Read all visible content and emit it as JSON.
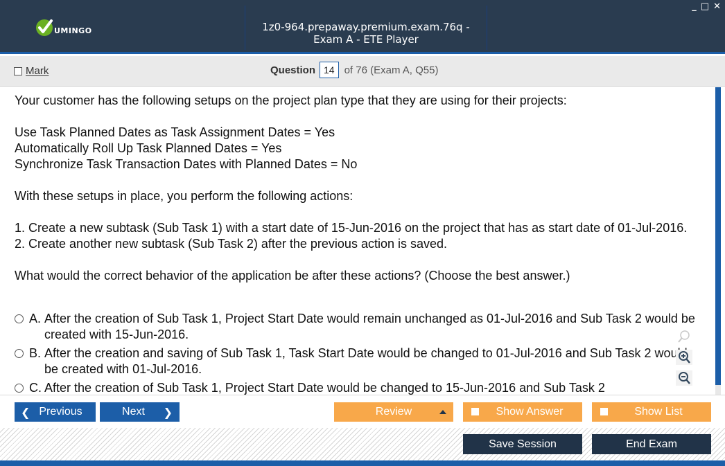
{
  "window": {
    "title": "1z0-964.prepaway.premium.exam.76q - Exam A - ETE Player",
    "logo_text": "UMINGO",
    "controls": [
      "_",
      "□",
      "✕"
    ]
  },
  "header": {
    "mark_label": "Mark",
    "question_label": "Question",
    "question_number": "14",
    "question_of": "of 76 (Exam A, Q55)"
  },
  "question": {
    "intro": "Your customer has the following setups on the project plan type that they are using for their projects:",
    "setups": [
      "Use Task Planned Dates as Task Assignment Dates = Yes",
      "Automatically Roll Up Task Planned Dates = Yes",
      "Synchronize Task Transaction Dates with Planned Dates = No"
    ],
    "actions_intro": "With these setups in place, you perform the following actions:",
    "actions": [
      "1. Create a new subtask (Sub Task 1) with a start date of 15-Jun-2016 on the project that has as start date of 01-Jul-2016.",
      "2. Create another new subtask (Sub Task 2) after the previous action is saved."
    ],
    "prompt": "What would the correct behavior of the application be after these actions? (Choose the best answer.)"
  },
  "answers": [
    {
      "letter": "A.",
      "text": "After the creation of Sub Task 1, Project Start Date would remain unchanged as 01-Jul-2016 and Sub Task 2 would be created with 15-Jun-2016."
    },
    {
      "letter": "B.",
      "text": "After the creation and saving of Sub Task 1, Task Start Date would be changed to 01-Jul-2016 and Sub Task 2 would be created with 01-Jul-2016."
    },
    {
      "letter": "C.",
      "text": "After the creation of Sub Task 1, Project Start Date would be changed to 15-Jun-2016 and Sub Task 2"
    }
  ],
  "nav": {
    "previous": "Previous",
    "next": "Next",
    "review": "Review",
    "show_answer": "Show Answer",
    "show_list": "Show List"
  },
  "footer": {
    "save_session": "Save Session",
    "end_exam": "End Exam"
  },
  "colors": {
    "titlebar": "#2a3c50",
    "accent_blue": "#1c5ea8",
    "orange": "#f8a84a",
    "dark_button": "#213348",
    "logo_green": "#6ab023"
  }
}
